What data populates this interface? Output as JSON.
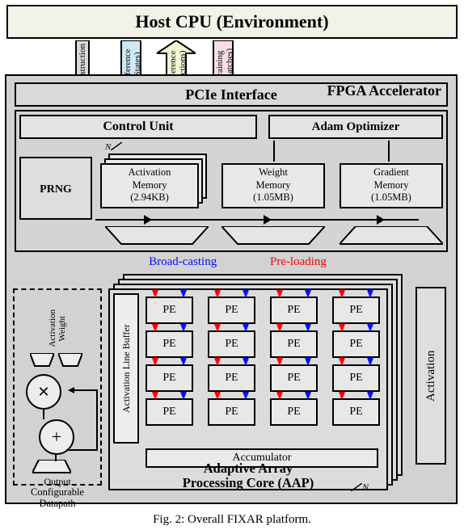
{
  "host": {
    "title": "Host CPU (Environment)"
  },
  "arrows": {
    "instruction": "Instruction",
    "inference_states": "Inference\n(States)",
    "inference_actions": "Inference\n(Actions)",
    "training_batches": "Training\n(Batches)"
  },
  "fpga": {
    "title": "FPGA Accelerator",
    "pcie": "PCIe Interface",
    "control_unit": "Control Unit",
    "adam": "Adam Optimizer",
    "prng": "PRNG",
    "activation_mem": {
      "line1": "Activation",
      "line2": "Memory",
      "line3": "(2.94KB)"
    },
    "weight_mem": {
      "line1": "Weight",
      "line2": "Memory",
      "line3": "(1.05MB)"
    },
    "gradient_mem": {
      "line1": "Gradient",
      "line2": "Memory",
      "line3": "(1.05MB)"
    },
    "N_upper": "N",
    "N_lower": "N"
  },
  "flow": {
    "broadcast": "Broad-casting",
    "preload": "Pre-loading"
  },
  "datapath": {
    "activation": "Activation",
    "weight": "Weight",
    "output": "Output",
    "title_line1": "Configurable",
    "title_line2": "Datapath"
  },
  "aap": {
    "alb": "Activation Line Buffer",
    "pe": "PE",
    "accumulator": "Accumulator",
    "title_line1": "Adaptive Array",
    "title_line2": "Processing Core (AAP)"
  },
  "activation_block": "Activation",
  "caption": "Fig. 2: Overall FIXAR platform."
}
